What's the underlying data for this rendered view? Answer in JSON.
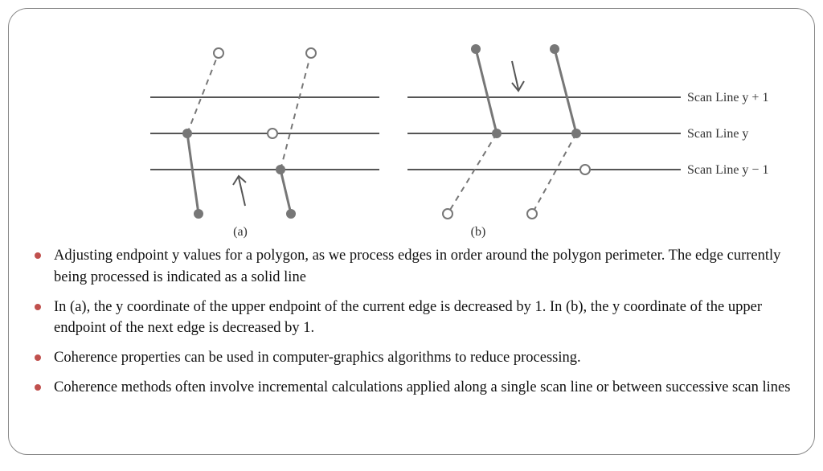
{
  "figure": {
    "scan_lines": {
      "top": "Scan Line y + 1",
      "middle": "Scan Line y",
      "bottom": "Scan Line y − 1"
    },
    "panel_a_label": "(a)",
    "panel_b_label": "(b)"
  },
  "bullets": [
    "Adjusting endpoint y values for a polygon, as we process edges in order around the polygon perimeter. The edge currently being processed is indicated as a solid line",
    "In (a), the y coordinate of the upper endpoint of the current edge is decreased by 1. In (b), the y coordinate of the upper endpoint of the next edge is decreased by 1.",
    "Coherence properties can be used in computer-graphics algorithms to reduce processing.",
    "Coherence methods often involve incremental calculations applied along a single scan line or between successive scan lines"
  ]
}
